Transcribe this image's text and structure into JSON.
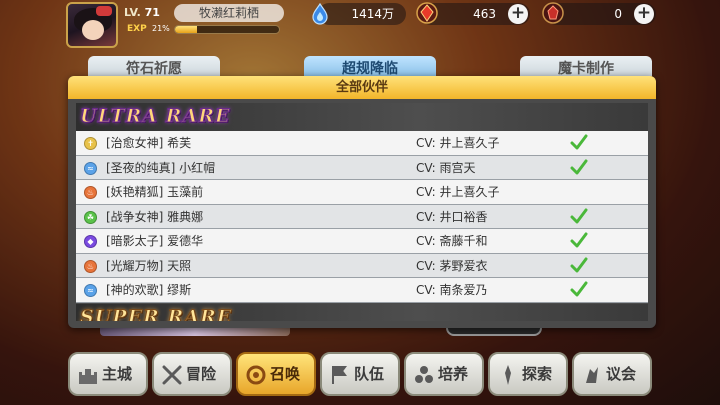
{
  "player": {
    "level_prefix": "LV.",
    "level": "71",
    "name": "牧濑红莉栖",
    "exp_label": "EXP",
    "exp_percent": "21%",
    "exp_fraction": 0.21
  },
  "currencies": [
    {
      "icon": "blue-flame-icon",
      "value": "1414万"
    },
    {
      "icon": "red-gem-icon",
      "value": "463"
    },
    {
      "icon": "red-crystal-icon",
      "value": "0"
    }
  ],
  "tabs": [
    {
      "label": "符石祈愿",
      "active": false
    },
    {
      "label": "超规降临",
      "active": true
    },
    {
      "label": "魔卡制作",
      "active": false
    }
  ],
  "panel": {
    "title": "全部伙伴",
    "sections": [
      {
        "rarity": "ULTRA RARE",
        "rows": [
          {
            "element": "light",
            "elem_color": "#e8c24a",
            "glyph": "✝",
            "title": "[治愈女神] 希芙",
            "cv": "CV:  井上喜久子",
            "owned": true
          },
          {
            "element": "water",
            "elem_color": "#5aa2e8",
            "glyph": "≈",
            "title": "[圣夜的纯真] 小红帽",
            "cv": "CV:  雨宫天",
            "owned": true
          },
          {
            "element": "fire",
            "elem_color": "#e8743a",
            "glyph": "♨",
            "title": "[妖艳精狐] 玉藻前",
            "cv": "CV:  井上喜久子",
            "owned": false
          },
          {
            "element": "wind",
            "elem_color": "#5ac24a",
            "glyph": "☘",
            "title": "[战争女神] 雅典娜",
            "cv": "CV:  井口裕香",
            "owned": true
          },
          {
            "element": "dark",
            "elem_color": "#7a4ae0",
            "glyph": "◆",
            "title": "[暗影太子] 爱德华",
            "cv": "CV:  斋藤千和",
            "owned": true
          },
          {
            "element": "fire",
            "elem_color": "#e8743a",
            "glyph": "♨",
            "title": "[光耀万物] 天照",
            "cv": "CV:  茅野爱衣",
            "owned": true
          },
          {
            "element": "water",
            "elem_color": "#5aa2e8",
            "glyph": "≈",
            "title": "[神的欢歌] 缪斯",
            "cv": "CV:  南条爱乃",
            "owned": true
          }
        ]
      },
      {
        "rarity": "SUPER RARE",
        "rows": []
      }
    ]
  },
  "nav": [
    {
      "label": "主城",
      "icon": "castle-icon",
      "active": false
    },
    {
      "label": "冒险",
      "icon": "crossed-swords-icon",
      "active": false
    },
    {
      "label": "召唤",
      "icon": "summon-circle-icon",
      "active": true
    },
    {
      "label": "队伍",
      "icon": "team-flag-icon",
      "active": false
    },
    {
      "label": "培养",
      "icon": "training-orbs-icon",
      "active": false
    },
    {
      "label": "探索",
      "icon": "explore-icon",
      "active": false
    },
    {
      "label": "议会",
      "icon": "council-icon",
      "active": false
    }
  ]
}
